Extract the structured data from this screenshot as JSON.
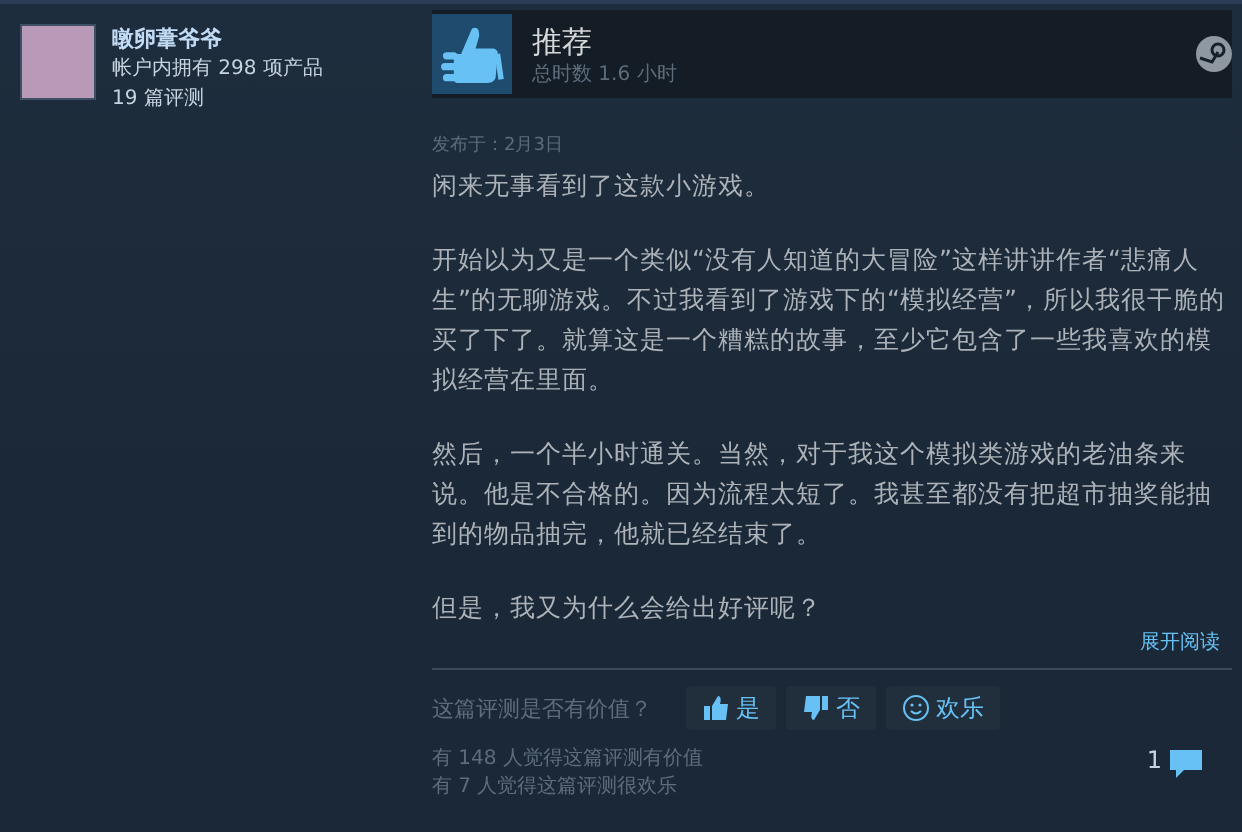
{
  "author": {
    "name": "暾卵葦爷爷",
    "products": "帐户内拥有 298 项产品",
    "reviews": "19 篇评测"
  },
  "review": {
    "recommended": true,
    "verdict": "推荐",
    "hours": "总时数 1.6 小时",
    "posted": "发布于：2月3日",
    "paragraphs": [
      "闲来无事看到了这款小游戏。",
      "开始以为又是一个类似“没有人知道的大冒险”这样讲讲作者“悲痛人生”的无聊游戏。不过我看到了游戏下的“模拟经营”，所以我很干脆的买了下了。就算这是一个糟糕的故事，至少它包含了一些我喜欢的模拟经营在里面。",
      "然后，一个半小时通关。当然，对于我这个模拟类游戏的老油条来说。他是不合格的。因为流程太短了。我甚至都没有把超市抽奖能抽到的物品抽完，他就已经结束了。",
      "但是，我又为什么会给出好评呢？"
    ],
    "expand": "展开阅读"
  },
  "feedback": {
    "question": "这篇评测是否有价值？",
    "buttons": [
      {
        "kind": "up",
        "label": "是"
      },
      {
        "kind": "down",
        "label": "否"
      },
      {
        "kind": "funny",
        "label": "欢乐"
      }
    ],
    "helpful": "有 148 人觉得这篇评测有价值",
    "funny": "有 7 人觉得这篇评测很欢乐",
    "comments": "1"
  }
}
